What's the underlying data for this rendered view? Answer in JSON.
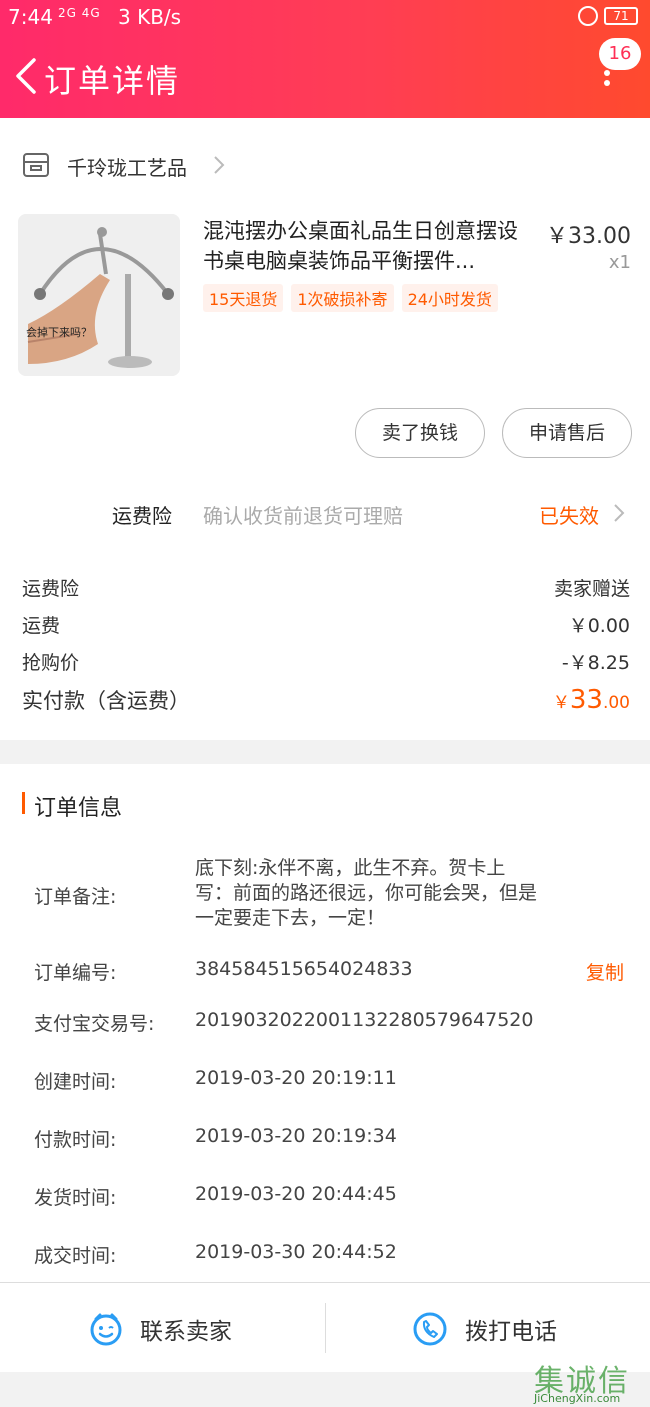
{
  "status_bar": {
    "time": "7:44",
    "signal": "2G 4G",
    "speed": "3 KB/s",
    "battery": "71"
  },
  "nav": {
    "title": "订单详情",
    "message_count": "16"
  },
  "shop": {
    "name": "千玲珑工艺品"
  },
  "product": {
    "title": "混沌摆办公桌面礼品生日创意摆设书桌电脑桌装饰品平衡摆件...",
    "image_caption": "会掉下来吗？",
    "price": "￥33.00",
    "quantity": "x1",
    "tags": [
      "15天退货",
      "1次破损补寄",
      "24小时发货"
    ]
  },
  "actions": {
    "sell_label": "卖了换钱",
    "after_sale_label": "申请售后"
  },
  "insurance": {
    "label": "运费险",
    "description": "确认收货前退货可理赔",
    "status": "已失效"
  },
  "costs": {
    "insurance_label": "运费险",
    "insurance_value": "卖家赠送",
    "shipping_label": "运费",
    "shipping_value": "￥0.00",
    "discount_label": "抢购价",
    "discount_value": "-￥8.25",
    "total_label": "实付款（含运费）",
    "total_currency": "￥",
    "total_int": "33",
    "total_dec": ".00"
  },
  "order_info": {
    "title": "订单信息",
    "note_label": "订单备注:",
    "note_value": "底下刻:永伴不离，此生不弃。贺卡上写：前面的路还很远，你可能会哭，但是一定要走下去，一定！",
    "number_label": "订单编号:",
    "number_value": "384584515654024833",
    "copy_label": "复制",
    "alipay_label": "支付宝交易号:",
    "alipay_value": "2019032022001132280579647520",
    "created_label": "创建时间:",
    "created_value": "2019-03-20 20:19:11",
    "paid_label": "付款时间:",
    "paid_value": "2019-03-20 20:19:34",
    "shipped_label": "发货时间:",
    "shipped_value": "2019-03-20 20:44:45",
    "closed_label": "成交时间:",
    "closed_value": "2019-03-30 20:44:52"
  },
  "footer": {
    "contact_label": "联系卖家",
    "call_label": "拨打电话"
  },
  "watermark": {
    "logo": "集诚信",
    "url": "JiChengXin.com"
  },
  "colors": {
    "header_start": "#ff2a6a",
    "header_end": "#ff4a2e",
    "accent": "#ff5a00",
    "icon_blue": "#2a9df4"
  },
  "icons": [
    "back-icon",
    "more-icon",
    "shop-icon",
    "chevron-right-icon",
    "contact-seller-icon",
    "phone-icon"
  ]
}
